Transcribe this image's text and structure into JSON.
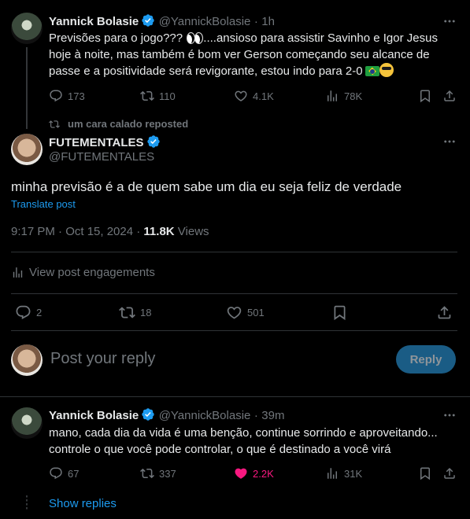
{
  "colors": {
    "accent": "#1d9bf0",
    "like_active": "#f91880",
    "muted": "#71767b",
    "text": "#e7e9ea"
  },
  "post1": {
    "name": "Yannick Bolasie",
    "handle": "@YannickBolasie",
    "time": "1h",
    "text_a": "Previsões para o jogo???",
    "text_b": "....ansioso para assistir Savinho e Igor Jesus",
    "text_c": "hoje à noite, mas também é bom ver Gerson começando seu alcance de",
    "text_d": "passe e a positividade será revigorante, estou indo para 2-0",
    "replies": "173",
    "reposts": "110",
    "likes": "4.1K",
    "views": "78K"
  },
  "repost_label": "um cara calado reposted",
  "main": {
    "name": "FUTEMENTALES",
    "handle": "@FUTEMENTALES",
    "text": "minha previsão é a de quem sabe um dia eu seja feliz de verdade",
    "translate": "Translate post",
    "timestamp": "9:17 PM · Oct 15, 2024 · ",
    "views_count": "11.8K",
    "views_label": " Views",
    "engagements": "View post engagements",
    "replies": "2",
    "reposts": "18",
    "likes": "501"
  },
  "composer": {
    "placeholder": "Post your reply",
    "button": "Reply"
  },
  "reply": {
    "name": "Yannick Bolasie",
    "handle": "@YannickBolasie",
    "time": "39m",
    "text_a": "mano, cada dia da vida é uma benção, continue sorrindo e aproveitando...",
    "text_b": "controle o que você pode controlar, o que é destinado a você virá",
    "replies": "67",
    "reposts": "337",
    "likes": "2.2K",
    "views": "31K",
    "show_replies": "Show replies"
  },
  "icons": [
    "verified-badge-icon",
    "more-icon",
    "reply-icon",
    "repost-icon",
    "like-icon",
    "views-icon",
    "bookmark-icon",
    "share-icon",
    "flag-brazil-icon",
    "sunglasses-emoji-icon",
    "eyes-emoji-icon"
  ]
}
